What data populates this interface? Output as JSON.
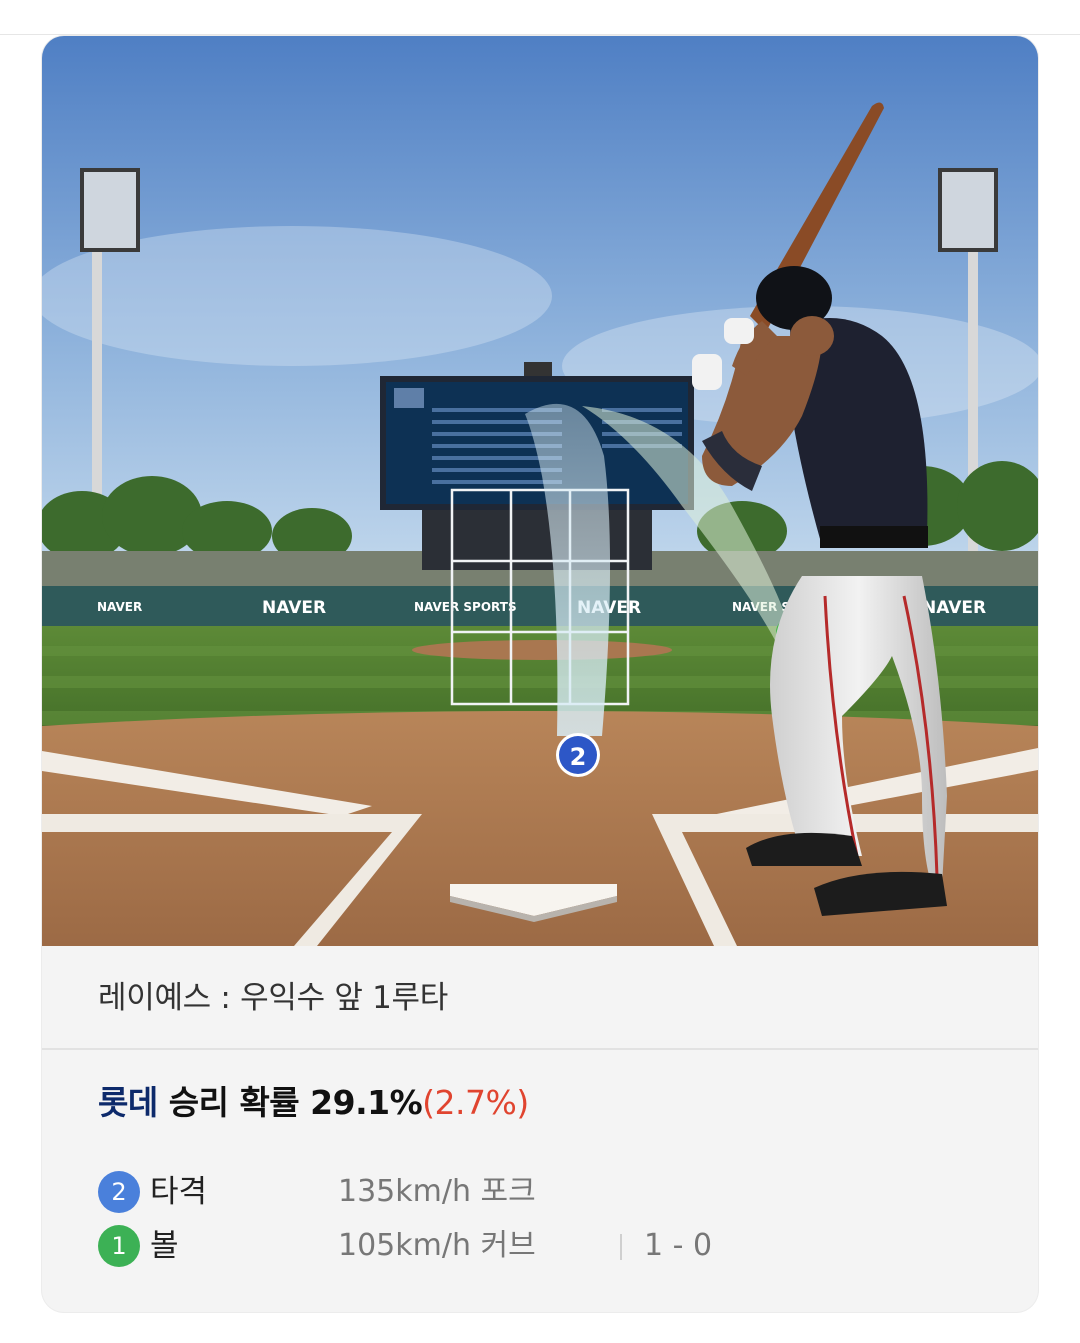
{
  "scene": {
    "ad_banners": [
      "NAVER",
      "NAVER",
      "NAVER SPORTS",
      "NAVER",
      "NAVER SPORTS",
      "NAVER"
    ],
    "pitch_markers": [
      {
        "number": "2",
        "color": "#2d57c7"
      }
    ],
    "colors": {
      "sky_top": "#4f7fc4",
      "sky_bottom": "#c6dbee",
      "grass": "#4e7a30",
      "dirt": "#b07a52",
      "wall": "#2f5a5a"
    }
  },
  "play": {
    "description": "레이예스 : 우익수 앞 1루타"
  },
  "win_probability": {
    "team": "롯데",
    "label": "승리 확률",
    "value": "29.1%",
    "delta": "(2.7%)"
  },
  "pitches": [
    {
      "number": "2",
      "result": "타격",
      "speed_type": "135km/h  포크",
      "count": "",
      "color": "#4a80db"
    },
    {
      "number": "1",
      "result": "볼",
      "speed_type": "105km/h  커브",
      "count": "1 - 0",
      "color": "#3cb155"
    }
  ]
}
